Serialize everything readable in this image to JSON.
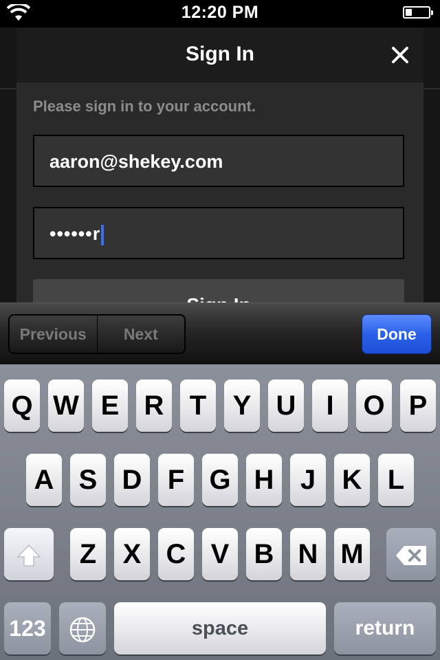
{
  "status_bar": {
    "time": "12:20 PM",
    "wifi_icon": "wifi-icon",
    "battery_icon": "battery-icon"
  },
  "modal": {
    "title": "Sign In",
    "close_icon": "close-icon",
    "prompt": "Please sign in to your account.",
    "email_value": "aaron@shekey.com",
    "password_value": "••••••r",
    "signin_label": "Sign In"
  },
  "toolbar": {
    "previous_label": "Previous",
    "next_label": "Next",
    "done_label": "Done"
  },
  "keyboard": {
    "row1": [
      "Q",
      "W",
      "E",
      "R",
      "T",
      "Y",
      "U",
      "I",
      "O",
      "P"
    ],
    "row2": [
      "A",
      "S",
      "D",
      "F",
      "G",
      "H",
      "J",
      "K",
      "L"
    ],
    "row3": [
      "Z",
      "X",
      "C",
      "V",
      "B",
      "N",
      "M"
    ],
    "numbers_label": "123",
    "space_label": "space",
    "return_label": "return"
  },
  "colors": {
    "done_blue": "#2a61e8",
    "caret_blue": "#3a6df0",
    "modal_bg": "#2a2a2a"
  }
}
